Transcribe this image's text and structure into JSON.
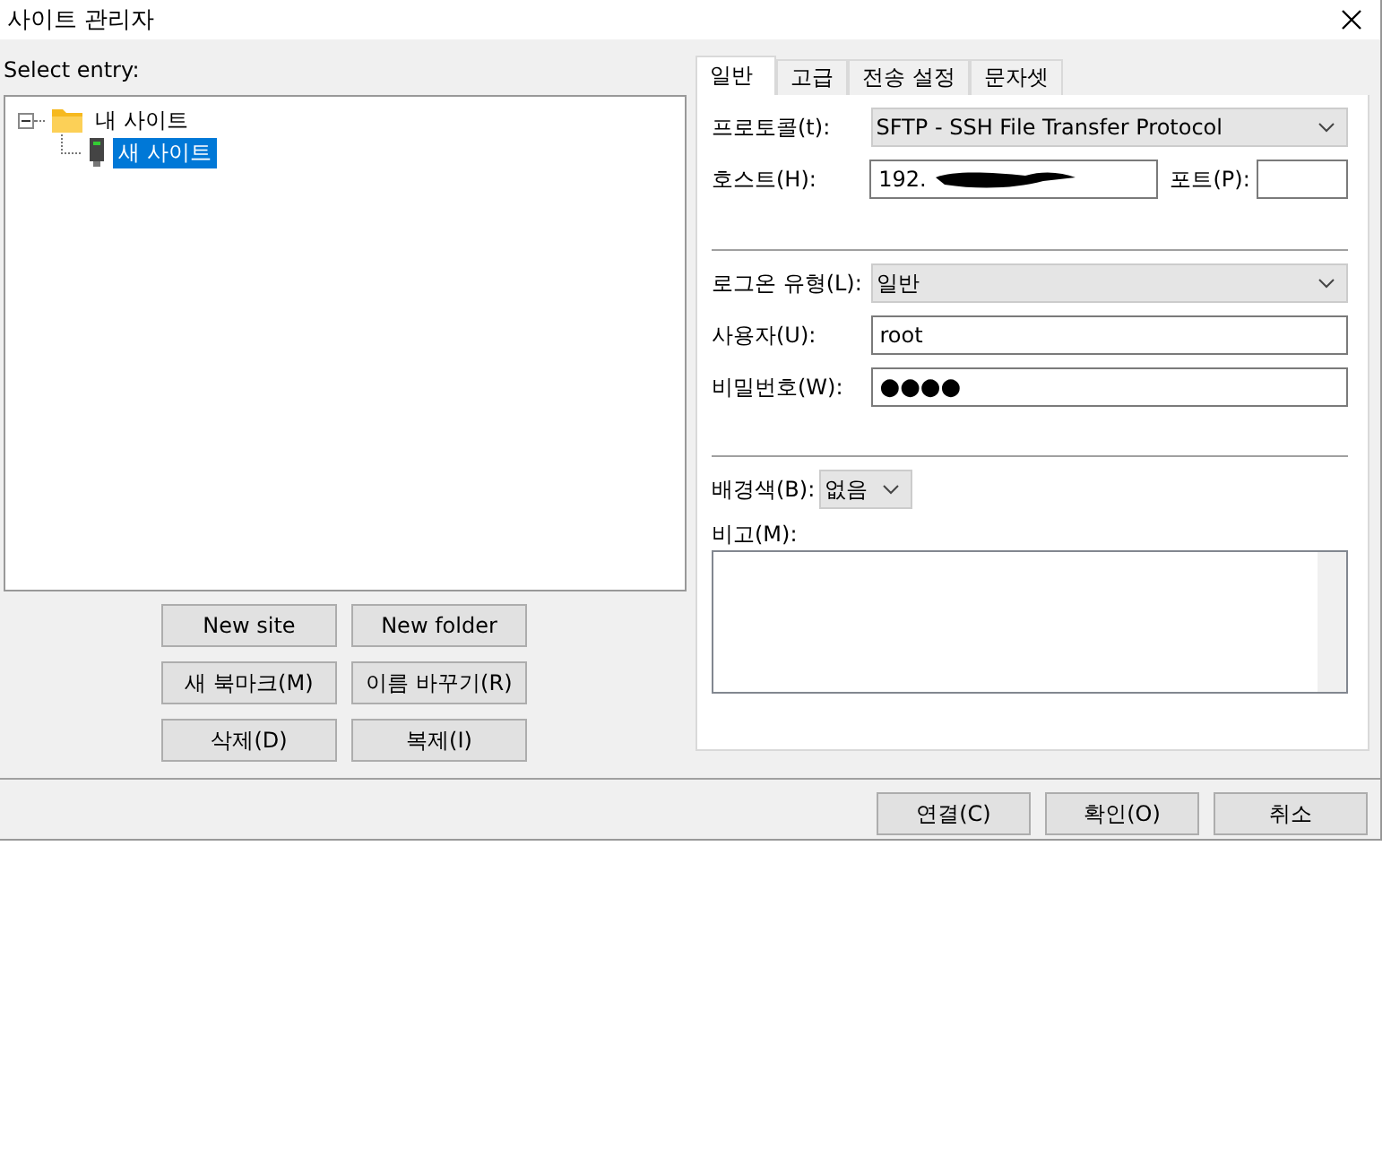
{
  "window": {
    "title": "사이트 관리자"
  },
  "tree": {
    "label": "Select entry:",
    "items": [
      {
        "label": "내 사이트",
        "kind": "folder",
        "expanded": true,
        "selected": false,
        "children": [
          {
            "label": "새 사이트",
            "kind": "site",
            "selected": true
          }
        ]
      }
    ]
  },
  "site_buttons": [
    "New site",
    "New folder",
    "새 북마크(M)",
    "이름 바꾸기(R)",
    "삭제(D)",
    "복제(I)"
  ],
  "tabs": [
    {
      "label": "일반",
      "selected": true
    },
    {
      "label": "고급",
      "selected": false
    },
    {
      "label": "전송 설정",
      "selected": false
    },
    {
      "label": "문자셋",
      "selected": false
    }
  ],
  "general": {
    "protocol": {
      "label": "프로토콜(t):",
      "value": "SFTP - SSH File Transfer Protocol"
    },
    "host": {
      "label": "호스트(H):",
      "value": "192.",
      "redacted": true
    },
    "port": {
      "label": "포트(P):"
    },
    "logon_type": {
      "label": "로그온 유형(L):",
      "value": "일반"
    },
    "user": {
      "label": "사용자(U):",
      "value": "root"
    },
    "password": {
      "label": "비밀번호(W):",
      "value": "●●●●"
    },
    "background": {
      "label": "배경색(B):",
      "value": "없음"
    },
    "comment": {
      "label": "비고(M):"
    }
  },
  "footer_buttons": [
    "연결(C)",
    "확인(O)",
    "취소"
  ]
}
